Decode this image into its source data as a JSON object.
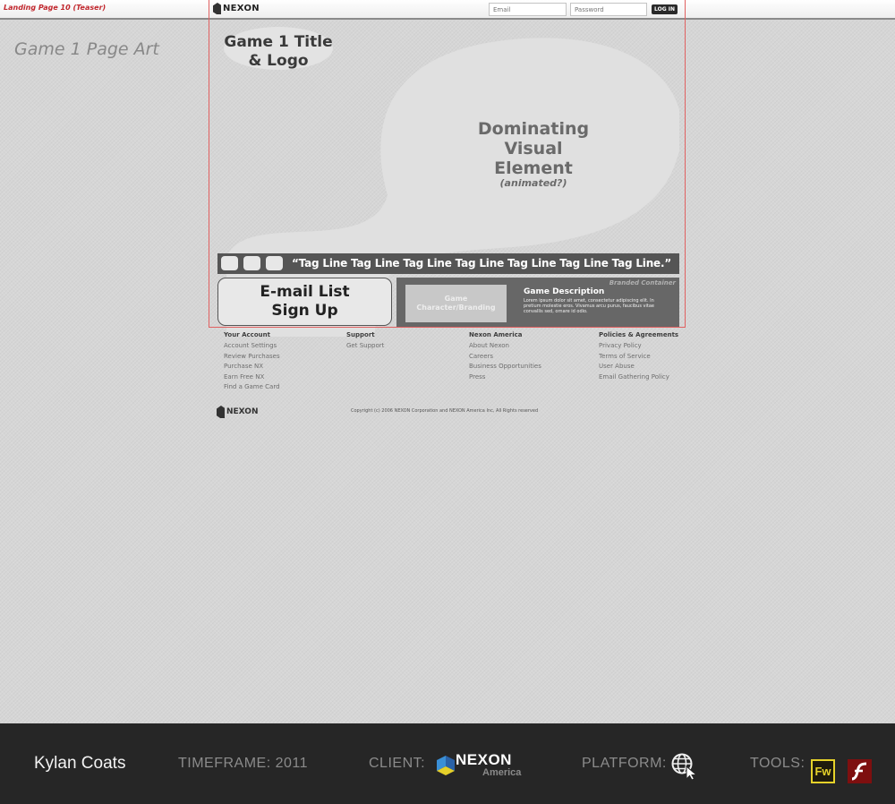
{
  "annotation": {
    "page_label": "Landing Page 10 (Teaser)",
    "page_art_label": "Game 1 Page Art"
  },
  "header": {
    "brand": "NEXON",
    "email_placeholder": "Email",
    "password_placeholder": "Password",
    "login_label": "LOG IN"
  },
  "hero": {
    "logo_line1": "Game 1 Title",
    "logo_line2": "& Logo",
    "visual_line1": "Dominating",
    "visual_line2": "Visual",
    "visual_line3": "Element",
    "visual_note": "(animated?)"
  },
  "tagline": "“Tag Line Tag Line Tag Line Tag Line Tag Line Tag Line Tag Line.”",
  "signup": {
    "line1": "E-mail List",
    "line2": "Sign Up"
  },
  "branded": {
    "label": "Branded Container",
    "character_line1": "Game",
    "character_line2": "Character/Branding",
    "description_title": "Game Description",
    "description_text": "Lorem ipsum dolor sit amet, consectetur adipiscing elit. In pretium molestie eros. Vivamus arcu purus, faucibus vitae convallis sed, ornare id odio."
  },
  "footer": {
    "columns": [
      {
        "heading": "Your Account",
        "links": [
          "Account Settings",
          "Review Purchases",
          "Purchase NX",
          "Earn Free NX",
          "Find a Game Card"
        ]
      },
      {
        "heading": "Support",
        "links": [
          "Get Support"
        ]
      },
      {
        "heading": "Nexon America",
        "links": [
          "About Nexon",
          "Careers",
          "Business Opportunities",
          "Press"
        ]
      },
      {
        "heading": "Policies & Agreements",
        "links": [
          "Privacy Policy",
          "Terms of Service",
          "User Abuse",
          "Email Gathering Policy"
        ]
      }
    ],
    "brand": "NEXON",
    "copyright": "Copyright (c) 2006 NEXON Corporation and NEXON America Inc, All Rights reserved"
  },
  "portfolio": {
    "author": "Kylan Coats",
    "timeframe": "TIMEFRAME: 2011",
    "client_label": "CLIENT:",
    "client_name": "NEXON",
    "client_sub": "America",
    "platform_label": "PLATFORM:",
    "tools_label": "TOOLS:",
    "fireworks_label": "Fw",
    "icons": {
      "platform": "globe-cursor-icon",
      "tool1": "fireworks-icon",
      "tool2": "flash-icon"
    },
    "colors": {
      "fireworks": "#e6d22a",
      "flash": "#7e0f0f"
    }
  }
}
